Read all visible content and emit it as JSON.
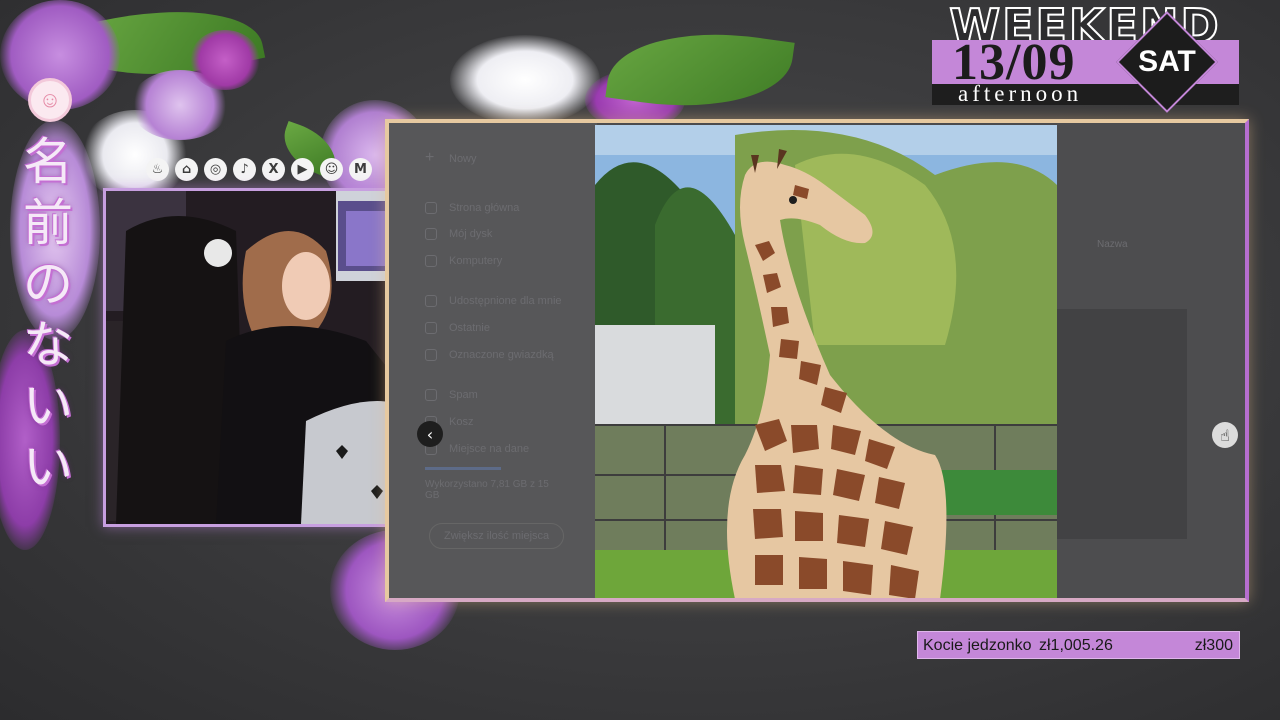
{
  "overlay": {
    "kanji": [
      "名",
      "前",
      "の",
      "な",
      "い",
      "い"
    ],
    "socials": [
      {
        "icon": "flame-icon",
        "glyph": "♨"
      },
      {
        "icon": "twitch-icon",
        "glyph": "⌂"
      },
      {
        "icon": "instagram-icon",
        "glyph": "◎"
      },
      {
        "icon": "tiktok-icon",
        "glyph": "♪"
      },
      {
        "icon": "x-icon",
        "glyph": "X"
      },
      {
        "icon": "youtube-icon",
        "glyph": "▶"
      },
      {
        "icon": "discord-icon",
        "glyph": "☺"
      },
      {
        "icon": "mail-icon",
        "glyph": "M"
      }
    ]
  },
  "banner": {
    "word": "WEEKEND",
    "date": "13/09",
    "day": "SAT",
    "period": "afternoon"
  },
  "goal": {
    "label": "Kocie jedzonko",
    "current": "zł1,005.26",
    "target": "zł300"
  },
  "drive": {
    "new_button": "Nowy",
    "items": [
      "Strona główna",
      "Mój dysk",
      "Komputery",
      "Udostępnione dla mnie",
      "Ostatnie",
      "Oznaczone gwiazdką",
      "Spam",
      "Kosz",
      "Miejsce na dane"
    ],
    "storage_text": "Wykorzystano 7,81 GB z 15 GB",
    "storage_button": "Zwiększ ilość miejsca",
    "sort_label": "Nazwa"
  },
  "viewer": {
    "prev_icon": "‹",
    "cursor_icon": "☝"
  },
  "colors": {
    "accent": "#c487d8",
    "frame": "#e6c9a0"
  }
}
